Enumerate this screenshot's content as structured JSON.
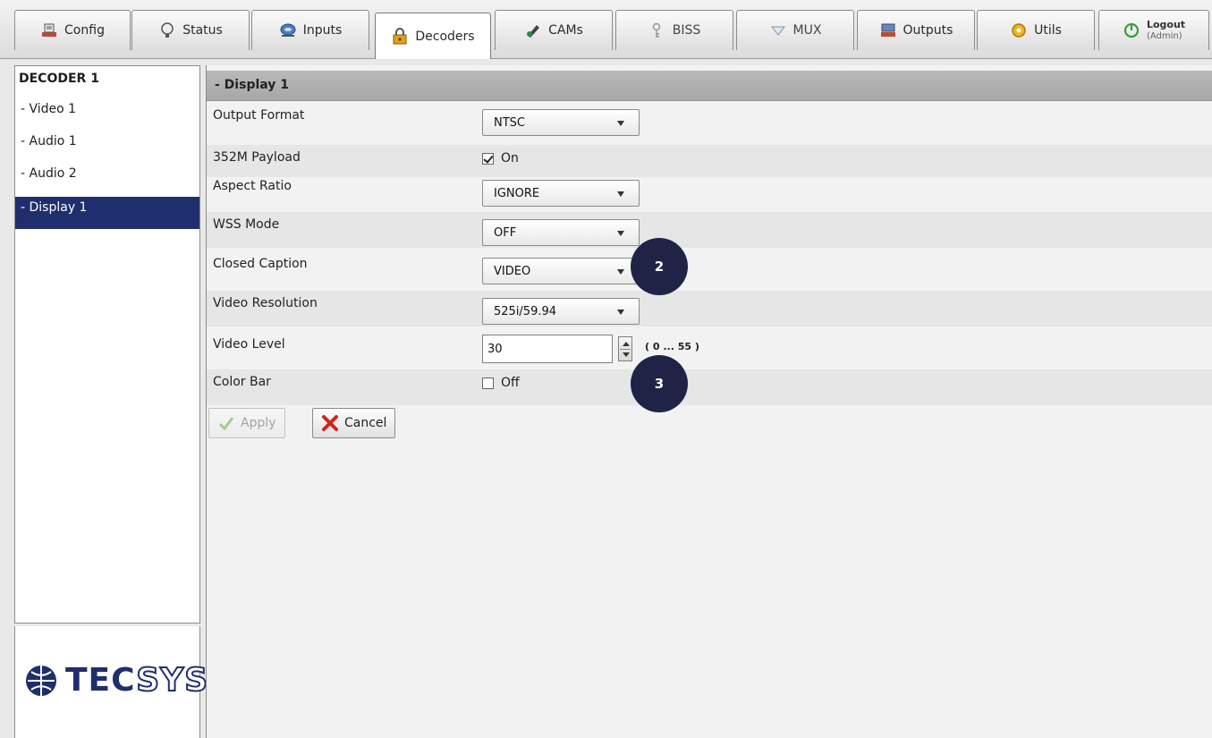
{
  "tabs": [
    {
      "label": "Config",
      "icon": "config-icon"
    },
    {
      "label": "Status",
      "icon": "status-icon"
    },
    {
      "label": "Inputs",
      "icon": "inputs-icon"
    },
    {
      "label": "Decoders",
      "icon": "decoders-icon",
      "active": true
    },
    {
      "label": "CAMs",
      "icon": "cams-icon"
    },
    {
      "label": "BISS",
      "icon": "biss-icon"
    },
    {
      "label": "MUX",
      "icon": "mux-icon"
    },
    {
      "label": "Outputs",
      "icon": "outputs-icon"
    },
    {
      "label": "Utils",
      "icon": "utils-icon"
    },
    {
      "label": "Logout",
      "sublabel": "(Admin)",
      "icon": "logout-icon"
    }
  ],
  "sidebar": {
    "title": "DECODER 1",
    "items": [
      {
        "label": "- Video 1"
      },
      {
        "label": "- Audio 1"
      },
      {
        "label": "- Audio 2"
      },
      {
        "label": "- Display 1",
        "active": true
      }
    ],
    "logo_tec": "TEC",
    "logo_sys": "SYS"
  },
  "main": {
    "section_title": "- Display 1",
    "fields": {
      "output_format": {
        "label": "Output Format",
        "value": "NTSC"
      },
      "payload_352m": {
        "label": "352M Payload",
        "value": "On",
        "checked": true
      },
      "aspect_ratio": {
        "label": "Aspect Ratio",
        "value": "IGNORE"
      },
      "wss_mode": {
        "label": "WSS Mode",
        "value": "OFF"
      },
      "closed_caption": {
        "label": "Closed Caption",
        "value": "VIDEO"
      },
      "video_resolution": {
        "label": "Video Resolution",
        "value": "525i/59.94"
      },
      "video_level": {
        "label": "Video Level",
        "value": "30",
        "range": "( 0 ... 55 )"
      },
      "color_bar": {
        "label": "Color Bar",
        "value": "Off",
        "checked": false
      }
    },
    "apply_label": "Apply",
    "cancel_label": "Cancel"
  },
  "callouts": [
    "2",
    "3"
  ],
  "colors": {
    "accent": "#1f2f6e",
    "callout": "#1f2447",
    "header_bar": "#aeaeae"
  }
}
